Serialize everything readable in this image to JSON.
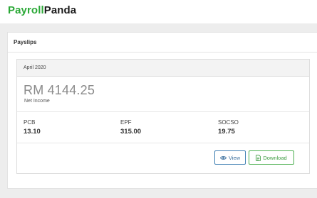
{
  "brand": {
    "part1": "Payroll",
    "part2": "Panda"
  },
  "panel": {
    "title": "Payslips"
  },
  "payslip": {
    "period": "April 2020",
    "net_income": "RM 4144.25",
    "net_income_label": "Net Income",
    "stats": [
      {
        "label": "PCB",
        "value": "13.10"
      },
      {
        "label": "EPF",
        "value": "315.00"
      },
      {
        "label": "SOCSO",
        "value": "19.75"
      }
    ],
    "view_label": "View",
    "download_label": "Download"
  },
  "colors": {
    "brand_green": "#2aa836",
    "view_blue": "#3f7fb3",
    "download_green": "#4caf50"
  },
  "icons": {
    "view": "eye-icon",
    "download": "file-icon"
  }
}
